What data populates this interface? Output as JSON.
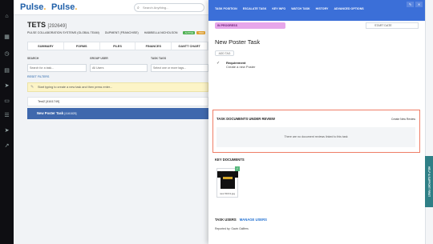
{
  "topbar": {
    "logo_left": "Pulse",
    "logo_right": "Pulse",
    "search_placeholder": "Search Anything..."
  },
  "job": {
    "title": "TETS",
    "id": "[292649]",
    "meta": [
      "PULSE COLLABORATION SYSTEMS (GLOBAL TEAM)",
      "DUPMENT (FRANCHISE)",
      "HABIBELLA NICHOLSON"
    ],
    "badges": [
      "ACTIVE",
      "TWO"
    ]
  },
  "tabs": [
    "SUMMARY",
    "FORMS",
    "FILES",
    "FINANCES",
    "GANTT CHART"
  ],
  "filters": {
    "search_label": "SEARCH",
    "search_placeholder": "Search for a task...",
    "group_label": "GROUP USER",
    "group_value": "All Users",
    "tags_label": "TASK TAGS",
    "tags_placeholder": "Select one or more tags...",
    "reset": "RESET FILTERS"
  },
  "new_task_placeholder": "Start typing to create a new task and then press enter...",
  "rows": [
    {
      "label": "Test2",
      "id": "[4161749]"
    },
    {
      "label": "New Poster Task",
      "id": "[4161825]"
    }
  ],
  "panel": {
    "actions": [
      "TASK POSITION",
      "ESCALATE TASK",
      "KEY INFO",
      "WATCH TASK",
      "HISTORY",
      "ADVANCED OPTIONS"
    ],
    "corner_icons": [
      "✎",
      "✕"
    ],
    "stage": "IN PROGRESS",
    "start_date_label": "START DATE",
    "title": "New Poster Task",
    "add_tag": "ADD TAG",
    "requirement_label": "Requirement",
    "requirement_text": "Create a new Poster",
    "review_heading": "TASK DOCUMENTS UNDER REVIEW",
    "review_link": "Create New Review",
    "review_empty": "There are no document reviews linked to this task",
    "key_docs_heading": "KEY DOCUMENTS",
    "key_doc_file": "new Shirt1.jpg",
    "task_users_heading": "TASK USERS",
    "manage_users": "MANAGE USERS",
    "reported_by": "Reported by: Gavin Gallfers"
  },
  "feedback_tab": "HELP & SUPPORT FIRST",
  "colors": {
    "panel_header": "#3b6fd8",
    "stage_pill": "#e7a6ea",
    "review_border": "#ef7d66",
    "selected_row": "#3f68ad"
  }
}
